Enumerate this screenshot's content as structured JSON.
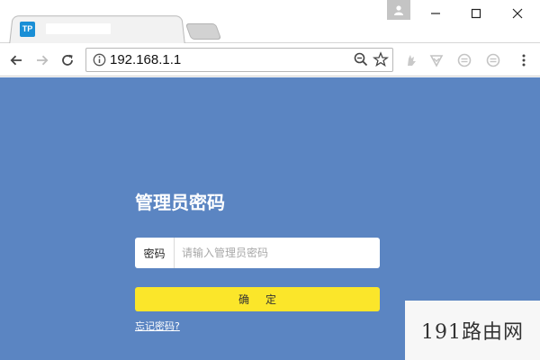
{
  "browser": {
    "tab": {
      "favicon_text": "TP"
    },
    "address": {
      "url": "192.168.1.1"
    }
  },
  "login": {
    "title": "管理员密码",
    "password_label": "密码",
    "password_placeholder": "请输入管理员密码",
    "confirm_label": "确定",
    "forgot_link": "忘记密码?"
  },
  "watermark": {
    "text": "191路由网"
  },
  "colors": {
    "page_background": "#5b85c2",
    "confirm_button": "#fbe62a",
    "favicon": "#1a8fd6"
  },
  "icons": {
    "tab": "tp-link-favicon",
    "toolbar": [
      "back-arrow-icon",
      "forward-arrow-icon",
      "reload-icon",
      "info-icon",
      "zoom-icon",
      "star-icon"
    ],
    "extensions": [
      "extension-hand-icon",
      "extension-shield-icon",
      "extension-circle-icon",
      "extension-circle-icon-2",
      "menu-dots-icon"
    ]
  }
}
